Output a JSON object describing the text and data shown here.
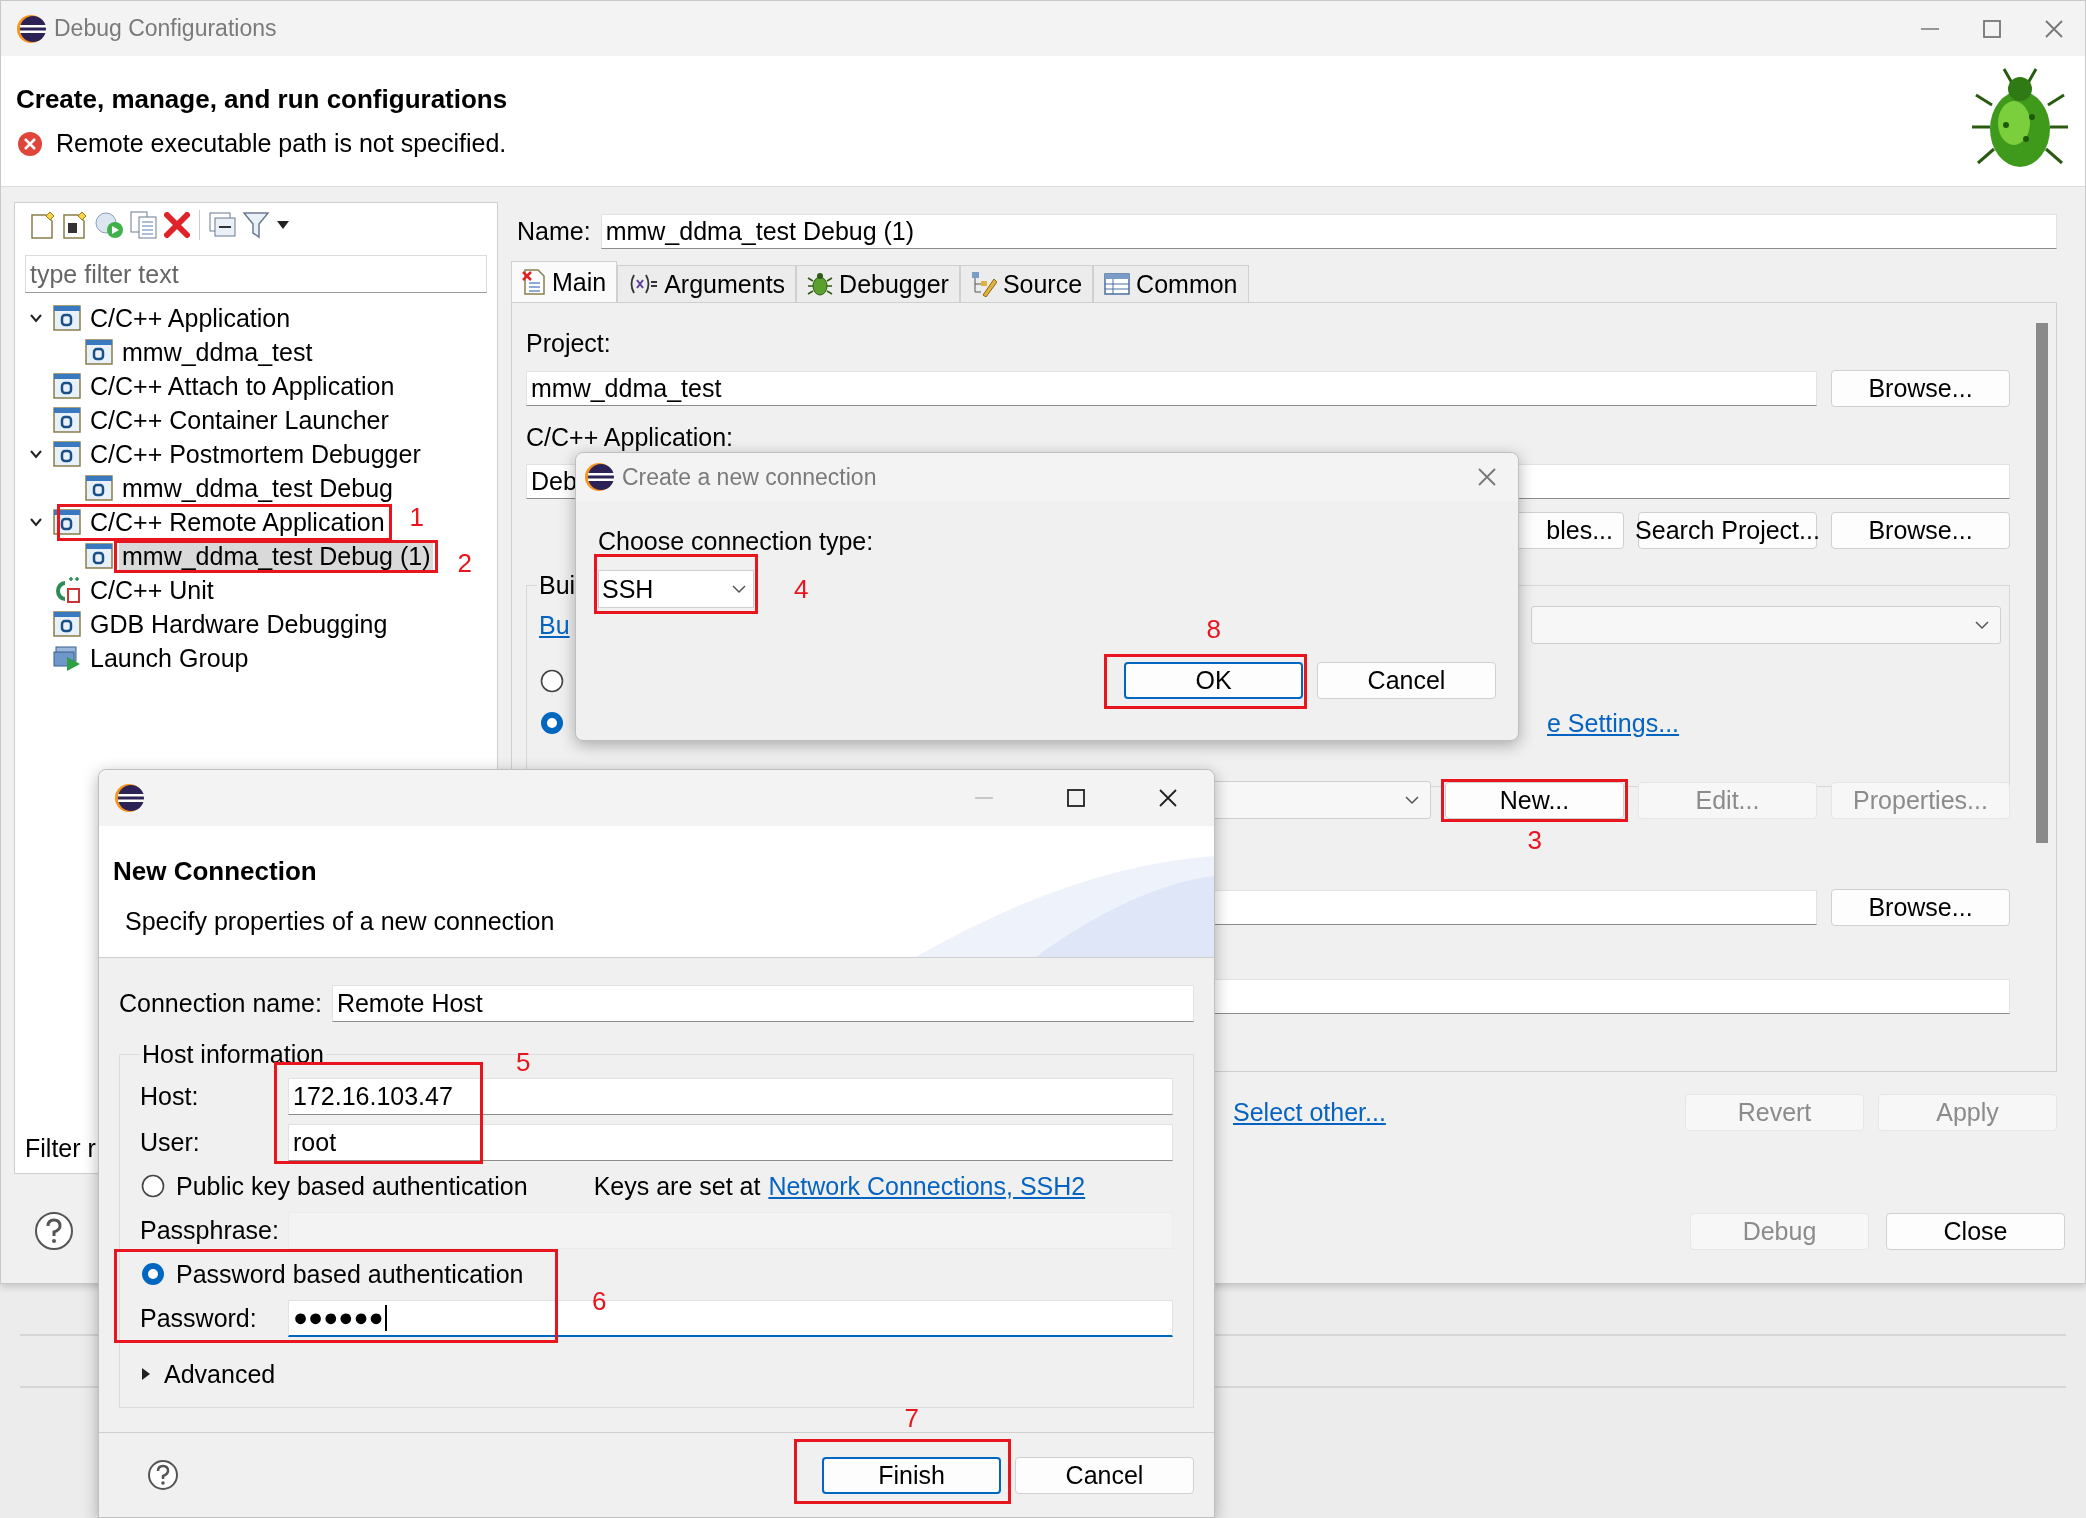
{
  "window": {
    "title": "Debug Configurations"
  },
  "header": {
    "title": "Create, manage, and run configurations",
    "message": "Remote executable path is not specified."
  },
  "filter": {
    "placeholder": "type filter text"
  },
  "tree": [
    {
      "label": "C/C++ Application",
      "kind": "config",
      "expanded": true,
      "selected": false,
      "children": [
        {
          "label": "mmw_ddma_test",
          "kind": "config",
          "selected": false
        }
      ]
    },
    {
      "label": "C/C++ Attach to Application",
      "kind": "config",
      "selected": false
    },
    {
      "label": "C/C++ Container Launcher",
      "kind": "config",
      "selected": false
    },
    {
      "label": "C/C++ Postmortem Debugger",
      "kind": "config",
      "expanded": true,
      "selected": false,
      "children": [
        {
          "label": "mmw_ddma_test Debug",
          "kind": "config",
          "selected": false
        }
      ]
    },
    {
      "label": "C/C++ Remote Application",
      "kind": "config",
      "expanded": true,
      "selected": false,
      "children": [
        {
          "label": "mmw_ddma_test Debug (1)",
          "kind": "config",
          "selected": true
        }
      ]
    },
    {
      "label": "C/C++ Unit",
      "kind": "unit",
      "selected": false
    },
    {
      "label": "GDB Hardware Debugging",
      "kind": "config",
      "selected": false
    },
    {
      "label": "Launch Group",
      "kind": "group",
      "selected": false
    }
  ],
  "filter_status": "Filter r",
  "config": {
    "name_label": "Name:",
    "name": "mmw_ddma_test Debug (1)",
    "tabs": [
      {
        "label": "Main",
        "kind": "main",
        "selected": true
      },
      {
        "label": "Arguments",
        "kind": "arguments",
        "selected": false
      },
      {
        "label": "Debugger",
        "kind": "debugger",
        "selected": false
      },
      {
        "label": "Source",
        "kind": "source",
        "selected": false
      },
      {
        "label": "Common",
        "kind": "common",
        "selected": false
      }
    ],
    "project_label": "Project:",
    "project": "mmw_ddma_test",
    "project_browse": {
      "label": "Browse...",
      "disabled": false
    },
    "application_label": "C/C++ Application:",
    "application": "Deb",
    "application_buttons": [
      {
        "label": "bles...",
        "disabled": false
      },
      {
        "label": "Search Project...",
        "disabled": false
      },
      {
        "label": "Browse...",
        "disabled": false
      }
    ],
    "build_group": {
      "label": "Bui",
      "link": "Bu",
      "options": [
        {
          "selected": false
        },
        {
          "selected": true,
          "link": "e Settings..."
        }
      ]
    },
    "connection_buttons": [
      {
        "label": "New...",
        "disabled": false
      },
      {
        "label": "Edit...",
        "disabled": true
      },
      {
        "label": "Properties...",
        "disabled": true
      }
    ],
    "remote_browse": {
      "label": "Browse...",
      "disabled": false
    }
  },
  "launcher_link": "Select other...",
  "apply_buttons": [
    {
      "label": "Revert",
      "disabled": true
    },
    {
      "label": "Apply",
      "disabled": true
    }
  ],
  "dialog_buttons": [
    {
      "label": "Debug",
      "disabled": true
    },
    {
      "label": "Close",
      "disabled": false
    }
  ],
  "create_dialog": {
    "title": "Create a new connection",
    "prompt": "Choose connection type:",
    "type": "SSH",
    "buttons": [
      {
        "label": "OK",
        "default": true
      },
      {
        "label": "Cancel",
        "default": false
      }
    ]
  },
  "new_connection": {
    "heading": "New Connection",
    "description": "Specify properties of a new connection",
    "connection_name_label": "Connection name:",
    "connection_name": "Remote Host",
    "group_label": "Host information",
    "host_label": "Host:",
    "host": "172.16.103.47",
    "user_label": "User:",
    "user": "root",
    "auth": [
      {
        "label": "Public key based authentication",
        "selected": false
      },
      {
        "label": "Password based authentication",
        "selected": true
      }
    ],
    "keys_text": "Keys are set at",
    "keys_link": "Network Connections, SSH2",
    "passphrase_label": "Passphrase:",
    "password_label": "Password:",
    "password": "●●●●●●",
    "password_focused": true,
    "advanced": {
      "label": "Advanced",
      "expanded": false
    },
    "buttons": [
      {
        "label": "Finish",
        "default": true
      },
      {
        "label": "Cancel",
        "default": false
      }
    ]
  },
  "annotations": [
    {
      "label": "1"
    },
    {
      "label": "2"
    },
    {
      "label": "3"
    },
    {
      "label": "4"
    },
    {
      "label": "5"
    },
    {
      "label": "6"
    },
    {
      "label": "7"
    },
    {
      "label": "8"
    }
  ]
}
